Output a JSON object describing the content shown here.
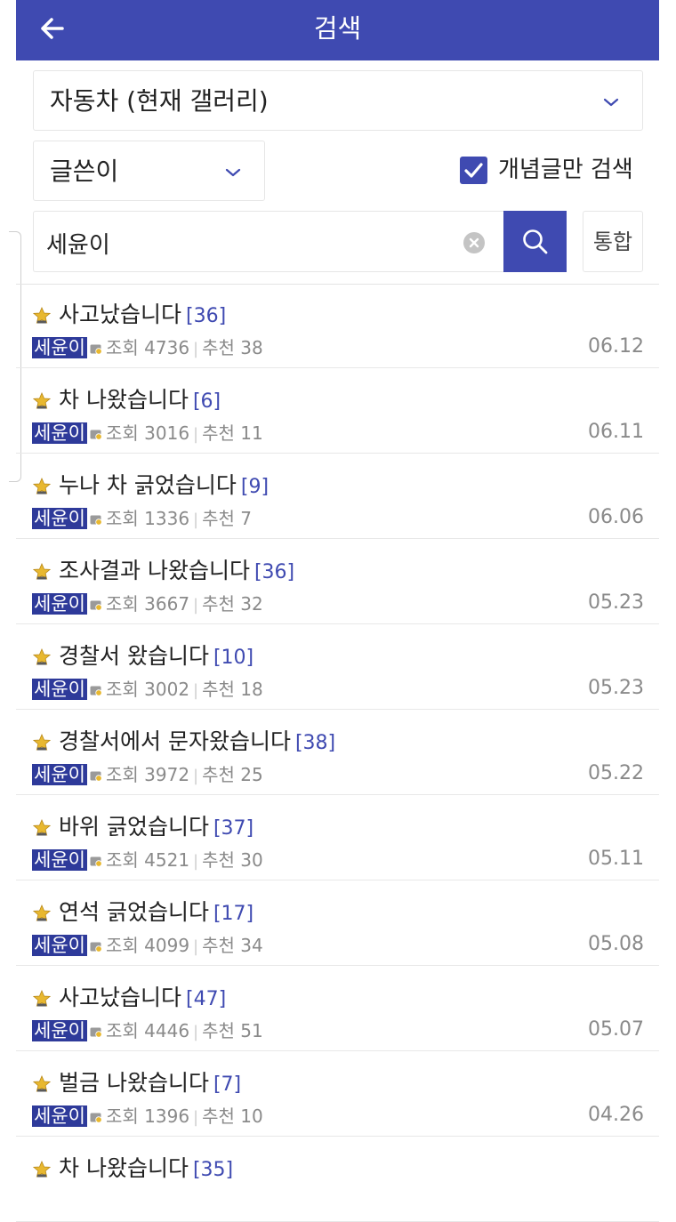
{
  "header": {
    "title": "검색"
  },
  "search": {
    "gallery": "자동차 (현재 갤러리)",
    "search_type": "글쓴이",
    "recommend_only_label": "개념글만 검색",
    "recommend_only_checked": true,
    "query": "세윤이",
    "unified_label": "통합"
  },
  "labels": {
    "views": "조회",
    "recommends": "추천"
  },
  "posts": [
    {
      "title": "사고났습니다",
      "comments": "[36]",
      "author": "세윤이",
      "views": "4736",
      "recommends": "38",
      "date": "06.12"
    },
    {
      "title": "차 나왔습니다",
      "comments": "[6]",
      "author": "세윤이",
      "views": "3016",
      "recommends": "11",
      "date": "06.11"
    },
    {
      "title": "누나 차 긁었습니다",
      "comments": "[9]",
      "author": "세윤이",
      "views": "1336",
      "recommends": "7",
      "date": "06.06"
    },
    {
      "title": "조사결과 나왔습니다",
      "comments": "[36]",
      "author": "세윤이",
      "views": "3667",
      "recommends": "32",
      "date": "05.23"
    },
    {
      "title": "경찰서 왔습니다",
      "comments": "[10]",
      "author": "세윤이",
      "views": "3002",
      "recommends": "18",
      "date": "05.23"
    },
    {
      "title": "경찰서에서 문자왔습니다",
      "comments": "[38]",
      "author": "세윤이",
      "views": "3972",
      "recommends": "25",
      "date": "05.22"
    },
    {
      "title": "바위 긁었습니다",
      "comments": "[37]",
      "author": "세윤이",
      "views": "4521",
      "recommends": "30",
      "date": "05.11"
    },
    {
      "title": "연석 긁었습니다",
      "comments": "[17]",
      "author": "세윤이",
      "views": "4099",
      "recommends": "34",
      "date": "05.08"
    },
    {
      "title": "사고났습니다",
      "comments": "[47]",
      "author": "세윤이",
      "views": "4446",
      "recommends": "51",
      "date": "05.07"
    },
    {
      "title": "벌금 나왔습니다",
      "comments": "[7]",
      "author": "세윤이",
      "views": "1396",
      "recommends": "10",
      "date": "04.26"
    },
    {
      "title": "차 나왔습니다",
      "comments": "[35]",
      "author": "",
      "views": "",
      "recommends": "",
      "date": ""
    }
  ],
  "colors": {
    "accent": "#3f4ab1",
    "author_bg": "#2e3a9a",
    "meta_text": "#8a8a8a",
    "star": "#e8b830"
  },
  "icons": {
    "back": "arrow-left-icon",
    "dropdown": "chevron-down-icon",
    "check": "check-icon",
    "clear": "clear-icon",
    "search": "search-icon",
    "star": "star-icon",
    "nick": "nick-icon"
  }
}
